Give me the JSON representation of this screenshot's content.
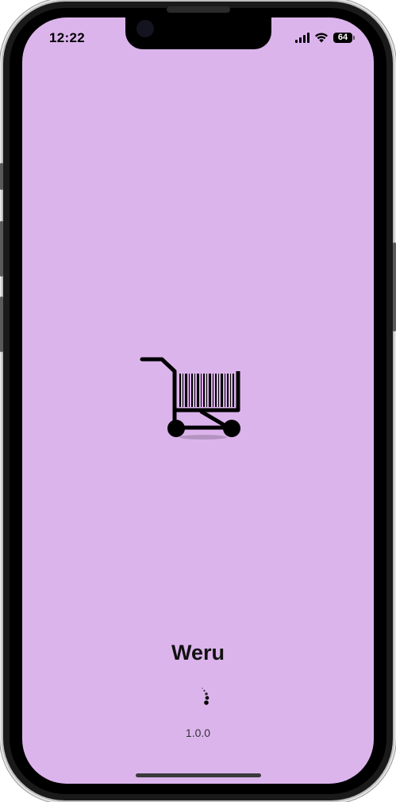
{
  "status_bar": {
    "time": "12:22",
    "battery_level": "64",
    "icons": [
      "cellular-signal-icon",
      "wifi-icon",
      "battery-icon"
    ]
  },
  "splash": {
    "app_name": "Weru",
    "version": "1.0.0",
    "logo_icon": "shopping-cart-barcode-icon",
    "loading_icon": "loading-spinner-icon"
  },
  "colors": {
    "background": "#dcb4ec",
    "logo": "#000000",
    "text": "#111111"
  }
}
